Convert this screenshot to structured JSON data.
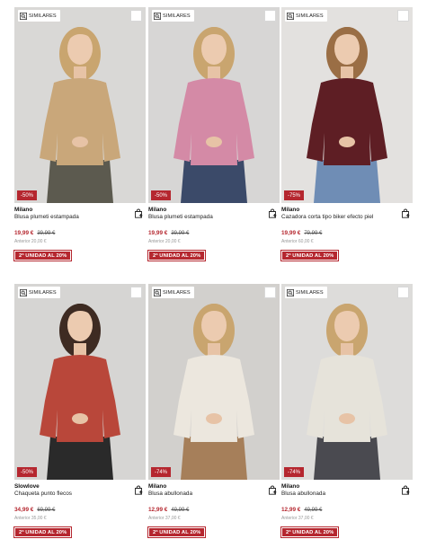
{
  "products": [
    {
      "similar_label": "SIMILARES",
      "discount": "-50%",
      "brand": "Milano",
      "name": "Blusa plumeti estampada",
      "price_now": "19,99 €",
      "price_old": "39,99 €",
      "price_prev": "Anterior 20,00 €",
      "promo": "2ª UNIDAD AL 20%",
      "colors": {
        "bg": "#d9d8d6",
        "top": "#c9a77a",
        "bottom": "#5c5a4f",
        "hair": "#c9a56f"
      }
    },
    {
      "similar_label": "SIMILARES",
      "discount": "-50%",
      "brand": "Milano",
      "name": "Blusa plumeti estampada",
      "price_now": "19,99 €",
      "price_old": "39,99 €",
      "price_prev": "Anterior 20,00 €",
      "promo": "2ª UNIDAD AL 20%",
      "colors": {
        "bg": "#d7d6d5",
        "top": "#d48aa6",
        "bottom": "#3b4a69",
        "hair": "#c9a56f"
      }
    },
    {
      "similar_label": "SIMILARES",
      "discount": "-75%",
      "brand": "Milano",
      "name": "Cazadora corta tipo biker efecto piel",
      "price_now": "19,99 €",
      "price_old": "79,99 €",
      "price_prev": "Anterior 60,00 €",
      "promo": "2ª UNIDAD AL 20%",
      "colors": {
        "bg": "#e3e1df",
        "top": "#5e1e24",
        "bottom": "#6f8db5",
        "hair": "#9a6e45"
      }
    },
    {
      "similar_label": "SIMILARES",
      "discount": "-50%",
      "brand": "Slowlove",
      "name": "Chaqueta punto flecos",
      "price_now": "34,99 €",
      "price_old": "69,99 €",
      "price_prev": "Anterior 35,00 €",
      "promo": "2ª UNIDAD AL 20%",
      "colors": {
        "bg": "#d6d5d3",
        "top": "#b9473a",
        "bottom": "#2a2a2a",
        "hair": "#3e2b22"
      }
    },
    {
      "similar_label": "SIMILARES",
      "discount": "-74%",
      "brand": "Milano",
      "name": "Blusa abullonada",
      "price_now": "12,99 €",
      "price_old": "49,99 €",
      "price_prev": "Anterior 37,00 €",
      "promo": "2ª UNIDAD AL 20%",
      "colors": {
        "bg": "#d2d0cd",
        "top": "#ece7de",
        "bottom": "#a67f5a",
        "hair": "#c9a56f"
      }
    },
    {
      "similar_label": "SIMILARES",
      "discount": "-74%",
      "brand": "Milano",
      "name": "Blusa abullonada",
      "price_now": "12,99 €",
      "price_old": "49,99 €",
      "price_prev": "Anterior 37,00 €",
      "promo": "2ª UNIDAD AL 20%",
      "colors": {
        "bg": "#dddcda",
        "top": "#e6e3da",
        "bottom": "#4a4a50",
        "hair": "#c9a56f"
      }
    }
  ]
}
